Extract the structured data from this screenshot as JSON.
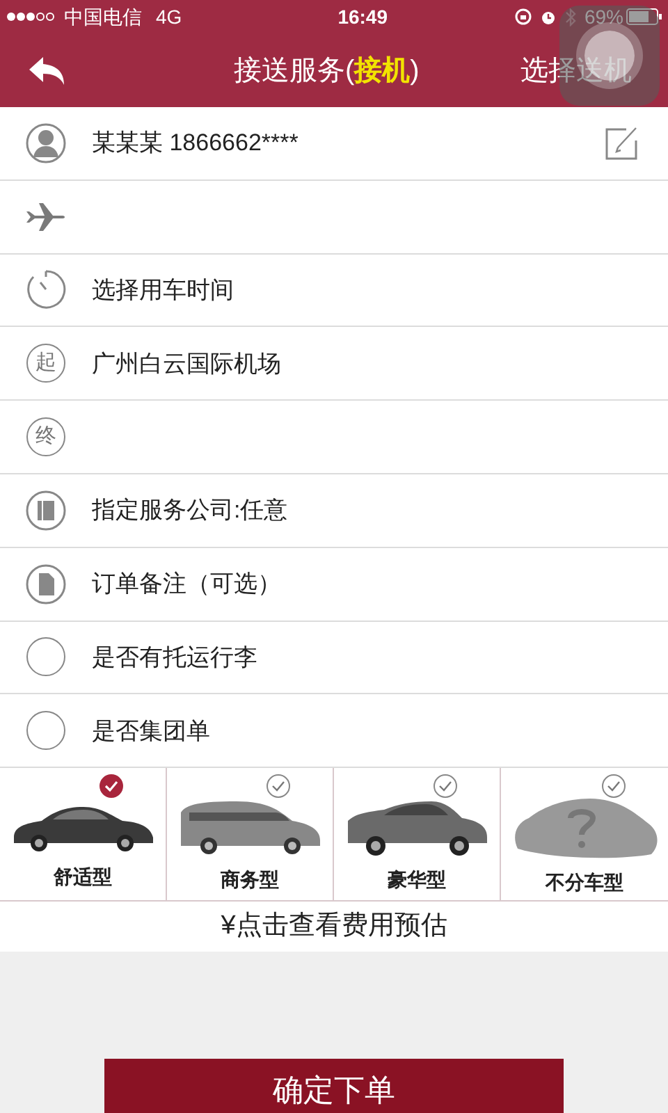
{
  "status_bar": {
    "carrier": "中国电信",
    "network": "4G",
    "time": "16:49",
    "battery": "69%"
  },
  "nav": {
    "title": "接送服务(**接机**)",
    "action": "选择送机"
  },
  "rows": [
    {
      "kind": "person",
      "text": "某某某 1866662****",
      "editable": true
    },
    {
      "kind": "plane",
      "text": ""
    },
    {
      "kind": "clock",
      "text": "选择用车时间"
    },
    {
      "kind": "badge",
      "badge": "起",
      "text": "广州白云国际机场"
    },
    {
      "kind": "badge",
      "badge": "终",
      "text": ""
    },
    {
      "kind": "company",
      "text": "指定服务公司:任意"
    },
    {
      "kind": "note",
      "text": "订单备注（可选）"
    },
    {
      "kind": "checkbox",
      "text": "是否有托运行李",
      "checked": false
    },
    {
      "kind": "checkbox",
      "text": "是否集团单",
      "checked": false
    }
  ],
  "vehicles": [
    {
      "kind": "sedan",
      "label": "舒适型",
      "selected": true
    },
    {
      "kind": "van",
      "label": "商务型",
      "selected": false
    },
    {
      "kind": "suv",
      "label": "豪华型",
      "selected": false
    },
    {
      "kind": "unknown",
      "label": "不分车型",
      "selected": false
    }
  ],
  "estimate": "¥点击查看费用预估",
  "submit": "确定下单"
}
